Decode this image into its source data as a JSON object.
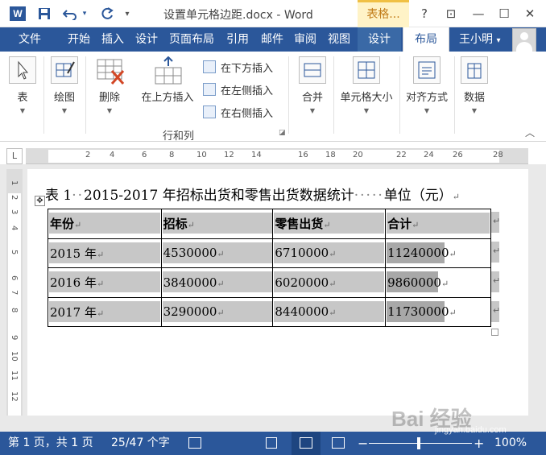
{
  "titlebar": {
    "app_logo": "W",
    "title": "设置单元格边距.docx - Word",
    "context_tab": "表格...",
    "help": "?",
    "ribbon_options": "⊡",
    "minimize": "—",
    "maximize": "☐",
    "close": "✕"
  },
  "tabs": {
    "file": "文件",
    "items": [
      "开始",
      "插入",
      "设计",
      "页面布局",
      "引用",
      "邮件",
      "审阅",
      "视图",
      "设计",
      "布局"
    ],
    "user": "王小明",
    "user_caret": "▾"
  },
  "ribbon": {
    "table": "表",
    "draw": "绘图",
    "delete": "删除",
    "insert_above": "在上方插入",
    "insert_below": "在下方插入",
    "insert_left": "在左侧插入",
    "insert_right": "在右侧插入",
    "group_rows_cols": "行和列",
    "merge": "合并",
    "cell_size": "单元格大小",
    "alignment": "对齐方式",
    "data": "数据"
  },
  "ruler": {
    "corner": "L",
    "h_numbers": [
      "2",
      "4",
      "6",
      "8",
      "10",
      "12",
      "14",
      "16",
      "18",
      "20",
      "22",
      "24",
      "26",
      "28"
    ],
    "v_numbers": [
      "1",
      "2",
      "3",
      "4",
      "5",
      "6",
      "7",
      "8",
      "9",
      "10",
      "11",
      "12"
    ]
  },
  "document": {
    "caption_left": "表 1",
    "caption_dots1": "··",
    "caption_mid": "2015-2017 年招标出货和零售出货数据统计",
    "caption_dots2": "·····",
    "caption_right": "单位（元）",
    "para_mark": "↵",
    "table": {
      "headers": [
        "年份",
        "招标",
        "零售出货",
        "合计"
      ],
      "rows": [
        [
          "2015 年",
          "4530000",
          "6710000",
          "11240000"
        ],
        [
          "2016 年",
          "3840000",
          "6020000",
          "9860000"
        ],
        [
          "2017 年",
          "3290000",
          "8440000",
          "11730000"
        ]
      ]
    }
  },
  "statusbar": {
    "page": "第 1 页，共 1 页",
    "words": "25/47 个字",
    "zoom_minus": "−",
    "zoom_plus": "+",
    "zoom": "100%"
  },
  "watermark": {
    "main": "Bai 经验",
    "sub": "jingyan.baidu.com"
  },
  "colors": {
    "brand": "#2b579a",
    "context_tab": "#f0c044",
    "cell_shading": "#c7c7c7"
  }
}
